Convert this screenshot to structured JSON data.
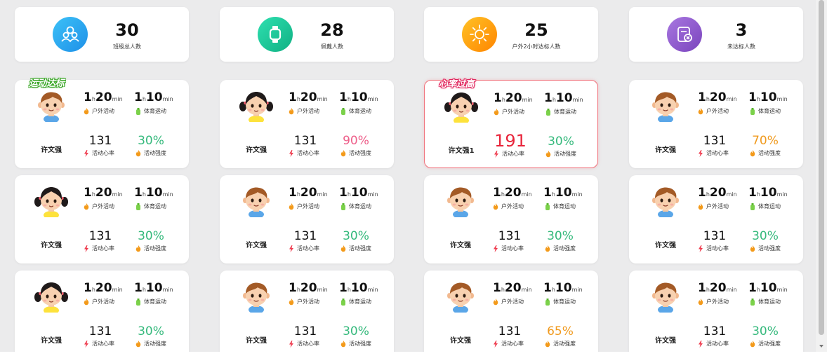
{
  "colors": {
    "green_value": "#35b97c",
    "pink_value": "#ee5f8a",
    "orange_value": "#f09a1e",
    "alert_red": "#e8243a",
    "icon_blue": "#2ba9ee",
    "icon_green": "#1cc497",
    "icon_orange": "#ff9d0c",
    "icon_purple": "#8a56c8"
  },
  "stats": [
    {
      "value": "30",
      "label": "班级总人数",
      "icon": "group-icon",
      "color": "#2ba9ee"
    },
    {
      "value": "28",
      "label": "佩戴人数",
      "icon": "watch-icon",
      "color": "#1cc497"
    },
    {
      "value": "25",
      "label": "户外2小时达标人数",
      "icon": "sun-icon",
      "color": "#ff9d0c"
    },
    {
      "value": "3",
      "label": "未达标人数",
      "icon": "report-fail-icon",
      "color": "#8a56c8"
    }
  ],
  "labels": {
    "outdoor": "户外活动",
    "pe": "体育运动",
    "heart": "活动心率",
    "intensity": "活动强度",
    "h_unit": "h",
    "min_unit": "min"
  },
  "students": [
    {
      "name": "许文强",
      "avatar": "boy",
      "badge": "运动达标",
      "badge_color": "green",
      "outdoor_h": "1",
      "outdoor_min": "20",
      "pe_h": "1",
      "pe_min": "10",
      "heart": "131",
      "intensity": "30%",
      "intensity_color": "#35b97c",
      "alert": false
    },
    {
      "name": "许文强",
      "avatar": "girl",
      "badge": "",
      "badge_color": "",
      "outdoor_h": "1",
      "outdoor_min": "20",
      "pe_h": "1",
      "pe_min": "10",
      "heart": "131",
      "intensity": "90%",
      "intensity_color": "#ee5f8a",
      "alert": false
    },
    {
      "name": "许文强1",
      "avatar": "girl",
      "badge": "心率过高",
      "badge_color": "red",
      "outdoor_h": "1",
      "outdoor_min": "20",
      "pe_h": "1",
      "pe_min": "10",
      "heart": "191",
      "intensity": "30%",
      "intensity_color": "#35b97c",
      "alert": true
    },
    {
      "name": "许文强",
      "avatar": "boy",
      "badge": "",
      "badge_color": "",
      "outdoor_h": "1",
      "outdoor_min": "20",
      "pe_h": "1",
      "pe_min": "10",
      "heart": "131",
      "intensity": "70%",
      "intensity_color": "#f09a1e",
      "alert": false
    },
    {
      "name": "许文强",
      "avatar": "girl",
      "badge": "",
      "badge_color": "",
      "outdoor_h": "1",
      "outdoor_min": "20",
      "pe_h": "1",
      "pe_min": "10",
      "heart": "131",
      "intensity": "30%",
      "intensity_color": "#35b97c",
      "alert": false
    },
    {
      "name": "许文强",
      "avatar": "boy",
      "badge": "",
      "badge_color": "",
      "outdoor_h": "1",
      "outdoor_min": "20",
      "pe_h": "1",
      "pe_min": "10",
      "heart": "131",
      "intensity": "30%",
      "intensity_color": "#35b97c",
      "alert": false
    },
    {
      "name": "许文强",
      "avatar": "boy",
      "badge": "",
      "badge_color": "",
      "outdoor_h": "1",
      "outdoor_min": "20",
      "pe_h": "1",
      "pe_min": "10",
      "heart": "131",
      "intensity": "30%",
      "intensity_color": "#35b97c",
      "alert": false
    },
    {
      "name": "许文强",
      "avatar": "boy",
      "badge": "",
      "badge_color": "",
      "outdoor_h": "1",
      "outdoor_min": "20",
      "pe_h": "1",
      "pe_min": "10",
      "heart": "131",
      "intensity": "30%",
      "intensity_color": "#35b97c",
      "alert": false
    },
    {
      "name": "许文强",
      "avatar": "girl",
      "badge": "",
      "badge_color": "",
      "outdoor_h": "1",
      "outdoor_min": "20",
      "pe_h": "1",
      "pe_min": "10",
      "heart": "131",
      "intensity": "30%",
      "intensity_color": "#35b97c",
      "alert": false
    },
    {
      "name": "许文强",
      "avatar": "boy",
      "badge": "",
      "badge_color": "",
      "outdoor_h": "1",
      "outdoor_min": "20",
      "pe_h": "1",
      "pe_min": "10",
      "heart": "131",
      "intensity": "30%",
      "intensity_color": "#35b97c",
      "alert": false
    },
    {
      "name": "许文强",
      "avatar": "boy",
      "badge": "",
      "badge_color": "",
      "outdoor_h": "1",
      "outdoor_min": "20",
      "pe_h": "1",
      "pe_min": "10",
      "heart": "131",
      "intensity": "65%",
      "intensity_color": "#f09a1e",
      "alert": false
    },
    {
      "name": "许文强",
      "avatar": "boy",
      "badge": "",
      "badge_color": "",
      "outdoor_h": "1",
      "outdoor_min": "20",
      "pe_h": "1",
      "pe_min": "10",
      "heart": "131",
      "intensity": "30%",
      "intensity_color": "#35b97c",
      "alert": false
    }
  ]
}
